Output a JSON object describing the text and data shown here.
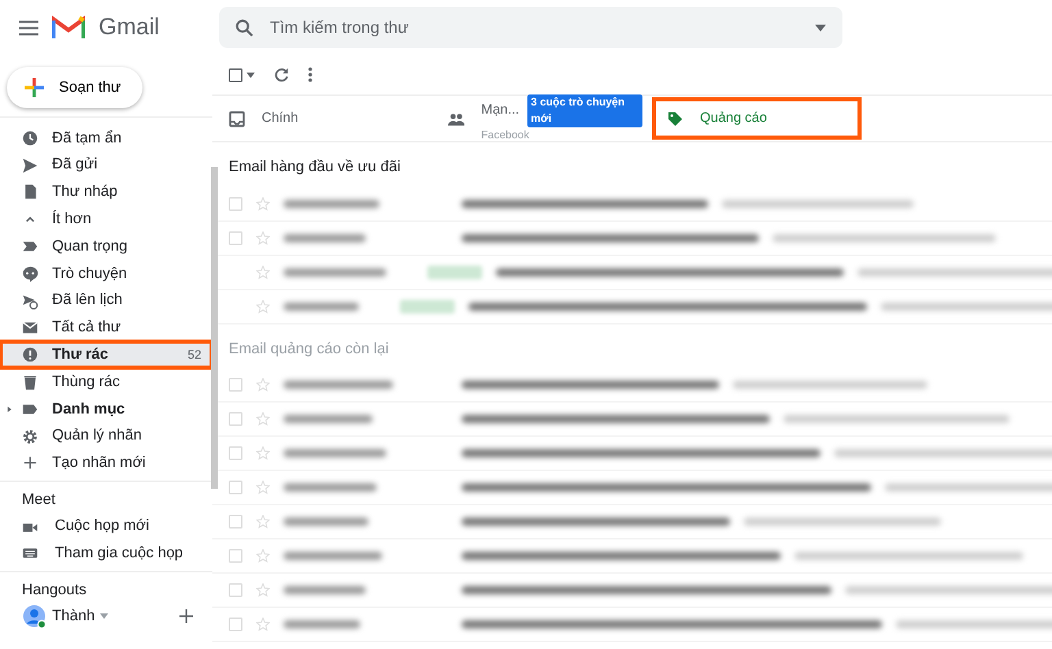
{
  "app": {
    "name": "Gmail"
  },
  "search": {
    "placeholder": "Tìm kiếm trong thư"
  },
  "compose": {
    "label": "Soạn thư"
  },
  "toolbar": {
    "checked": false
  },
  "sidebar": {
    "items": [
      {
        "label": "Đã tạm ẩn",
        "bold": false,
        "selected": false,
        "highlighted": false
      },
      {
        "label": "Đã gửi",
        "bold": false,
        "selected": false,
        "highlighted": false
      },
      {
        "label": "Thư nháp",
        "bold": false,
        "selected": false,
        "highlighted": false
      },
      {
        "label": "Ít hơn",
        "bold": false,
        "selected": false,
        "highlighted": false
      },
      {
        "label": "Quan trọng",
        "bold": false,
        "selected": false,
        "highlighted": false
      },
      {
        "label": "Trò chuyện",
        "bold": false,
        "selected": false,
        "highlighted": false
      },
      {
        "label": "Đã lên lịch",
        "bold": false,
        "selected": false,
        "highlighted": false
      },
      {
        "label": "Tất cả thư",
        "bold": false,
        "selected": false,
        "highlighted": false
      },
      {
        "label": "Thư rác",
        "count": "52",
        "bold": true,
        "selected": true,
        "highlighted": true
      },
      {
        "label": "Thùng rác",
        "bold": false,
        "selected": false,
        "highlighted": false
      },
      {
        "label": "Danh mục",
        "bold": true,
        "selected": false,
        "highlighted": false,
        "expanded": false
      },
      {
        "label": "Quản lý nhãn",
        "bold": false,
        "selected": false,
        "highlighted": false
      },
      {
        "label": "Tạo nhãn mới",
        "bold": false,
        "selected": false,
        "highlighted": false
      }
    ]
  },
  "meet": {
    "title": "Meet",
    "items": [
      {
        "label": "Cuộc họp mới"
      },
      {
        "label": "Tham gia cuộc họp"
      }
    ]
  },
  "hangouts": {
    "title": "Hangouts",
    "user": "Thành",
    "online": true
  },
  "tabs": [
    {
      "kind": "primary",
      "label": "Chính",
      "selected": false,
      "highlighted": false
    },
    {
      "kind": "social",
      "label": "Mạn...",
      "sublabel": "Facebook",
      "badge": "3 cuộc trò chuyện mới",
      "selected": false,
      "highlighted": false
    },
    {
      "kind": "promotions",
      "label": "Quảng cáo",
      "selected": true,
      "highlighted": true
    }
  ],
  "sections": [
    {
      "title": "Email hàng đầu về ưu đãi",
      "rows": [
        {
          "kind": "plain",
          "checked": false
        },
        {
          "kind": "plain",
          "checked": false
        },
        {
          "kind": "tagged"
        },
        {
          "kind": "tagged"
        }
      ]
    },
    {
      "title": "Email quảng cáo còn lại",
      "rows": [
        {
          "kind": "plain",
          "checked": false
        },
        {
          "kind": "plain",
          "checked": false
        },
        {
          "kind": "plain",
          "checked": false
        },
        {
          "kind": "plain",
          "checked": false
        },
        {
          "kind": "plain",
          "checked": false
        },
        {
          "kind": "plain",
          "checked": false
        },
        {
          "kind": "plain",
          "checked": false
        },
        {
          "kind": "plain",
          "checked": false
        }
      ]
    }
  ]
}
